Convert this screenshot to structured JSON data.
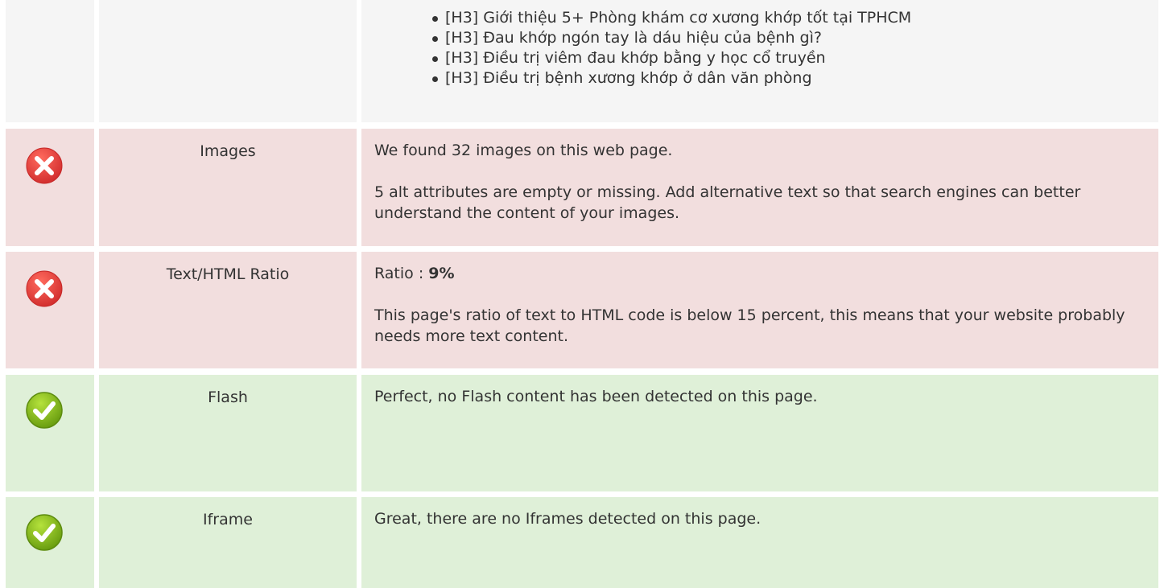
{
  "headings_list": [
    "[H3] Giới thiệu 5+ Phòng khám cơ xương khớp tốt tại TPHCM",
    "[H3] Đau khớp ngón tay là dáu hiệu của bệnh gì?",
    "[H3] Điều trị viêm đau khớp bằng y học cổ truyền",
    "[H3] Điều trị bệnh xương khớp ở dân văn phòng"
  ],
  "rows": [
    {
      "status": "error",
      "label": "Images",
      "text1": "We found 32 images on this web page.",
      "text2": "5 alt attributes are empty or missing. Add alternative text so that search engines can better understand the content of your images."
    },
    {
      "status": "error",
      "label": "Text/HTML Ratio",
      "ratio_prefix": "Ratio : ",
      "ratio_value": "9%",
      "text2": "This page's ratio of text to HTML code is below 15 percent, this means that your website probably needs more text content."
    },
    {
      "status": "ok",
      "label": "Flash",
      "text1": "Perfect, no Flash content has been detected on this page."
    },
    {
      "status": "ok",
      "label": "Iframe",
      "text1": "Great, there are no Iframes detected on this page."
    }
  ],
  "colors": {
    "error_bg": "#f2dede",
    "ok_bg": "#dff0d8",
    "neutral_bg": "#f5f5f5",
    "error_icon": "#e53935",
    "ok_icon": "#7cb518"
  },
  "icons": {
    "error": "error-x-icon",
    "ok": "check-ok-icon"
  }
}
